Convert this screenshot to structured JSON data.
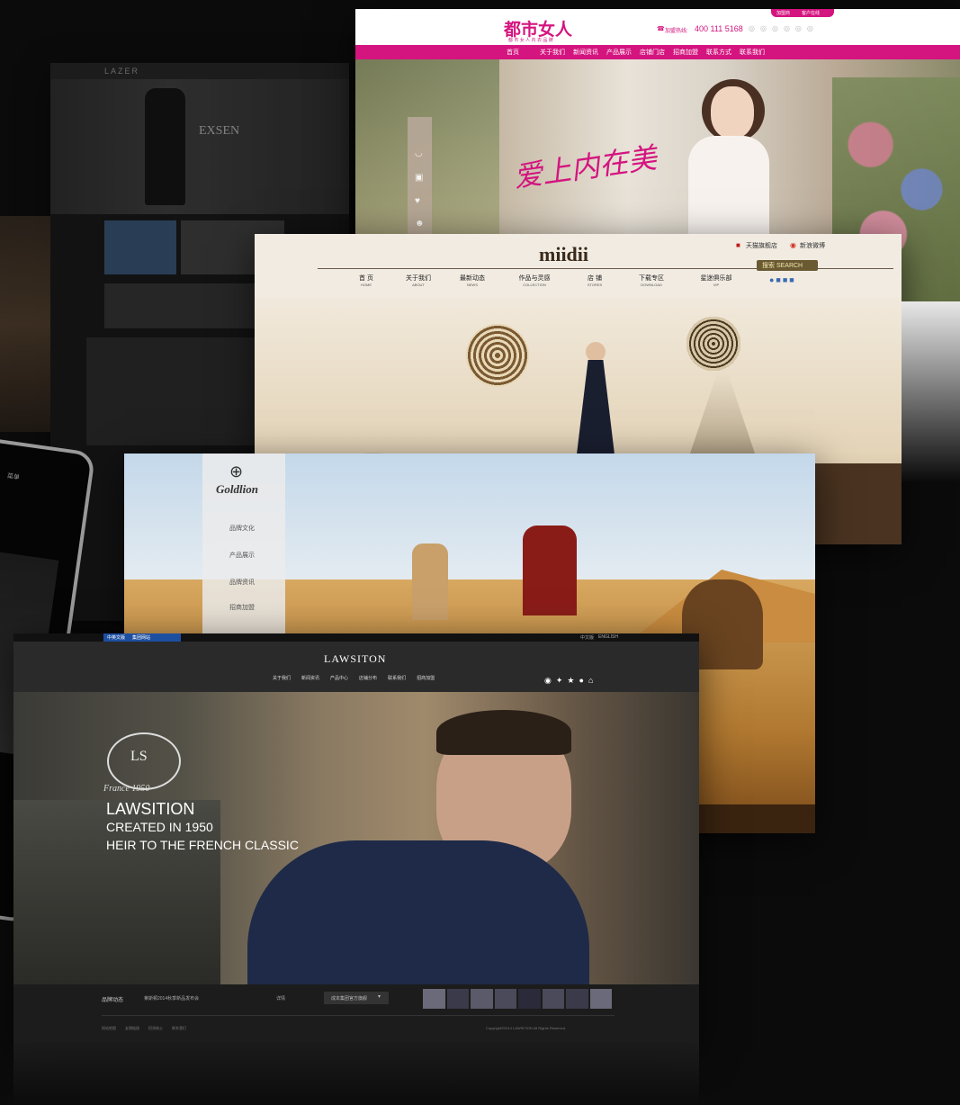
{
  "bg_site": {
    "logo": "LAZER",
    "hero_title": "EXSEN"
  },
  "pink_site": {
    "logo": "都市女人",
    "logo_sub": "都 市 女 人 内 衣 品 牌",
    "phone_label": "加盟热线:",
    "phone": "400 111 5168",
    "top_links": [
      "加盟商",
      "客户在线"
    ],
    "nav": [
      "首页",
      "关于我们",
      "新闻资讯",
      "产品展示",
      "店铺门店",
      "招商加盟",
      "联系方式",
      "联系我们"
    ],
    "hero_caption": "爱上内在美",
    "brand_color": "#d4147f"
  },
  "miidii": {
    "logo": "miidii",
    "top_right": [
      "天猫旗舰店",
      "新浪微博"
    ],
    "search_label": "搜索 SEARCH",
    "nav": [
      {
        "cn": "首 页",
        "en": "HOME"
      },
      {
        "cn": "关于我们",
        "en": "ABOUT"
      },
      {
        "cn": "最新动态",
        "en": "NEWS"
      },
      {
        "cn": "作品与灵感",
        "en": "COLLECTION"
      },
      {
        "cn": "店 铺",
        "en": "STORES"
      },
      {
        "cn": "下载专区",
        "en": "DOWNLOAD"
      },
      {
        "cn": "星迷俱乐部",
        "en": "VIP"
      }
    ]
  },
  "goldlion": {
    "logo": "Goldlion",
    "nav": [
      "品牌文化",
      "产品展示",
      "品牌资讯",
      "招商加盟"
    ]
  },
  "lawsition": {
    "top_left": [
      "中英文版",
      "集团网站"
    ],
    "top_right": [
      "中文版",
      "ENGLISH"
    ],
    "logo": "LAWSITON",
    "nav": [
      "关于我们",
      "新闻资讯",
      "产品中心",
      "店铺分布",
      "联系我们",
      "招商加盟"
    ],
    "crest_text": "France 1950",
    "hero_title": "LAWSITION",
    "hero_line1": "CREATED IN 1950",
    "hero_line2": "HEIR TO THE FRENCH CLASSIC",
    "news_label": "品牌动态",
    "news_text": "莱斯顿2014秋季新品发布会",
    "more": "详情",
    "select_label": "成本集团官方旗舰",
    "footer_links": [
      "网站地图",
      "友情链接",
      "招贤纳士",
      "联系我们"
    ],
    "copyright": "Copyright©2014 LAWSITION All Rights Reserved."
  },
  "tablet": {
    "menu_label": "菜单"
  },
  "colors": {
    "background": "#0b0b0b",
    "pink": "#d4147f",
    "miidii_bg": "#efe6d7",
    "lawsition_bar": "#1c1c1c",
    "lawsition_blue": "#1d4fa0"
  }
}
